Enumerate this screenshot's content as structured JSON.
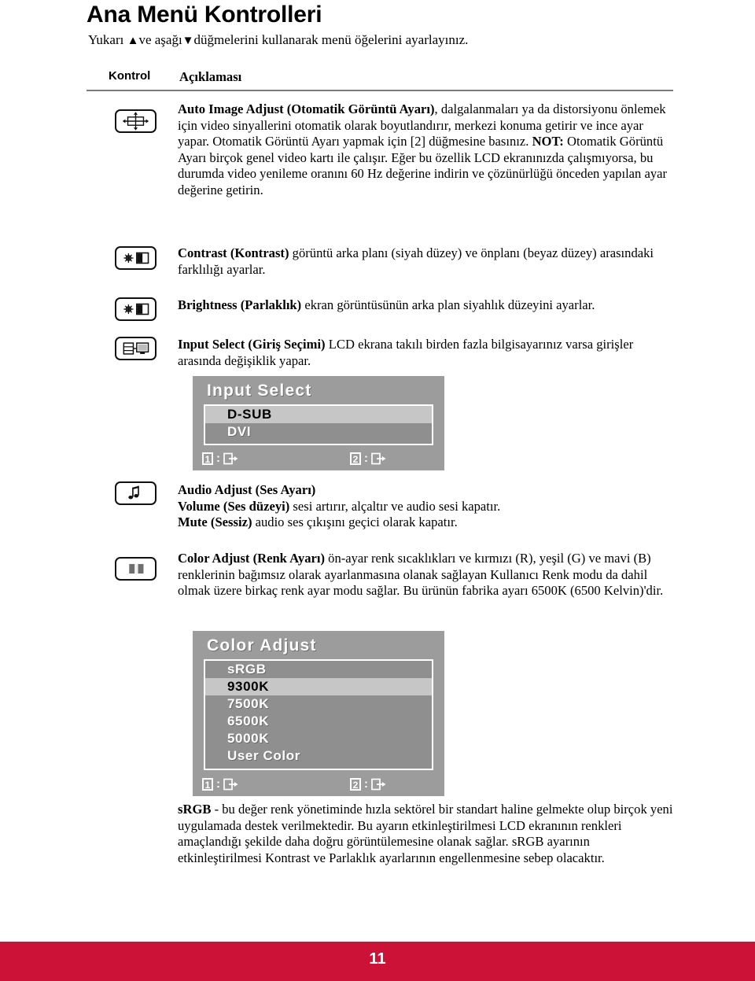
{
  "page": {
    "title": "Ana Menü Kontrolleri",
    "intro_before": "Yukarı ",
    "intro_up_arrow": "▲",
    "intro_middle": "ve aşağı",
    "intro_down_arrow": "▼",
    "intro_after": "düğmelerini kullanarak menü öğelerini ayarlayınız.",
    "page_number": "11",
    "footer_color": "#CC1236"
  },
  "columns": {
    "control": "Kontrol",
    "description": "Açıklaması"
  },
  "rows": [
    {
      "icon": "auto-image-adjust-icon",
      "paragraphs": [
        {
          "bold": "Auto Image Adjust (Otomatik Görüntü Ayarı)",
          "text": ", dalgalanmaları ya da distorsiyonu önlemek için video sinyallerini otomatik olarak boyutlandırır, merkezi konuma getirir ve ince ayar yapar. Otomatik Görüntü Ayarı yapmak için [2] düğmesine basınız."
        },
        {
          "bold": "NOT:",
          "text": " Otomatik Görüntü Ayarı birçok genel video kartı ile çalışır. Eğer bu özellik LCD ekranınızda çalışmıyorsa, bu durumda video yenileme oranını 60 Hz değerine indirin ve çözünürlüğü önceden yapılan ayar değerine getirin."
        }
      ]
    },
    {
      "icon": "contrast-icon",
      "paragraphs": [
        {
          "bold": "Contrast (Kontrast)",
          "text": " görüntü arka planı (siyah düzey) ve önplanı (beyaz düzey) arasındaki farklılığı ayarlar."
        }
      ]
    },
    {
      "icon": "brightness-icon",
      "paragraphs": [
        {
          "bold": "Brightness (Parlaklık)",
          "text": " ekran görüntüsünün arka plan siyahlık düzeyini ayarlar."
        }
      ]
    },
    {
      "icon": "input-select-icon",
      "paragraphs": [
        {
          "bold": "Input Select (Giriş Seçimi)",
          "text": " LCD ekrana takılı birden fazla bilgisayarınız varsa girişler arasında değişiklik yapar."
        }
      ]
    },
    {
      "icon": "audio-adjust-icon",
      "paragraphs": [
        {
          "bold": "Audio Adjust (Ses Ayarı)",
          "text": ""
        },
        {
          "bold": "Volume (Ses düzeyi)",
          "text": " sesi artırır, alçaltır ve audio sesi kapatır."
        },
        {
          "bold": "Mute (Sessiz)",
          "text": " audio ses çıkışını geçici olarak kapatır."
        }
      ]
    },
    {
      "icon": "color-adjust-icon",
      "paragraphs": [
        {
          "bold": "Color Adjust (Renk Ayarı)",
          "text": " ön-ayar renk sıcaklıkları ve kırmızı (R), yeşil (G) ve mavi (B) renklerinin bağımsız olarak ayarlanmasına olanak sağlayan Kullanıcı Renk modu da dahil olmak üzere birkaç renk ayar modu sağlar. Bu ürünün fabrika ayarı 6500K (6500 Kelvin)'dir."
        }
      ]
    }
  ],
  "osd_input_select": {
    "title": "Input Select",
    "items": [
      {
        "label": "D-SUB",
        "selected": true
      },
      {
        "label": "DVI",
        "selected": false
      }
    ],
    "footer": [
      {
        "key": "1",
        "separator": ":",
        "icon": "exit-icon"
      },
      {
        "key": "2",
        "separator": ":",
        "icon": "exit-icon"
      }
    ],
    "bg_color": "#9C9C9C",
    "selected_color": "#C6C6C6"
  },
  "osd_color_adjust": {
    "title": "Color Adjust",
    "items": [
      {
        "label": "sRGB",
        "selected": false
      },
      {
        "label": "9300K",
        "selected": true
      },
      {
        "label": "7500K",
        "selected": false
      },
      {
        "label": "6500K",
        "selected": false
      },
      {
        "label": "5000K",
        "selected": false
      },
      {
        "label": "User Color",
        "selected": false
      }
    ],
    "footer": [
      {
        "key": "1",
        "separator": ":",
        "icon": "exit-icon"
      },
      {
        "key": "2",
        "separator": ":",
        "icon": "exit-icon"
      }
    ],
    "bg_color": "#9C9C9C",
    "selected_color": "#C6C6C6"
  },
  "srgb_note": {
    "bold": "sRGB",
    "text": " - bu değer renk yönetiminde hızla sektörel bir standart haline gelmekte olup birçok yeni uygulamada destek verilmektedir. Bu ayarın etkinleştirilmesi LCD ekranının renkleri amaçlandığı şekilde daha doğru görüntülemesine olanak sağlar. sRGB ayarının etkinleştirilmesi Kontrast ve Parlaklık ayarlarının engellenmesine sebep olacaktır."
  }
}
